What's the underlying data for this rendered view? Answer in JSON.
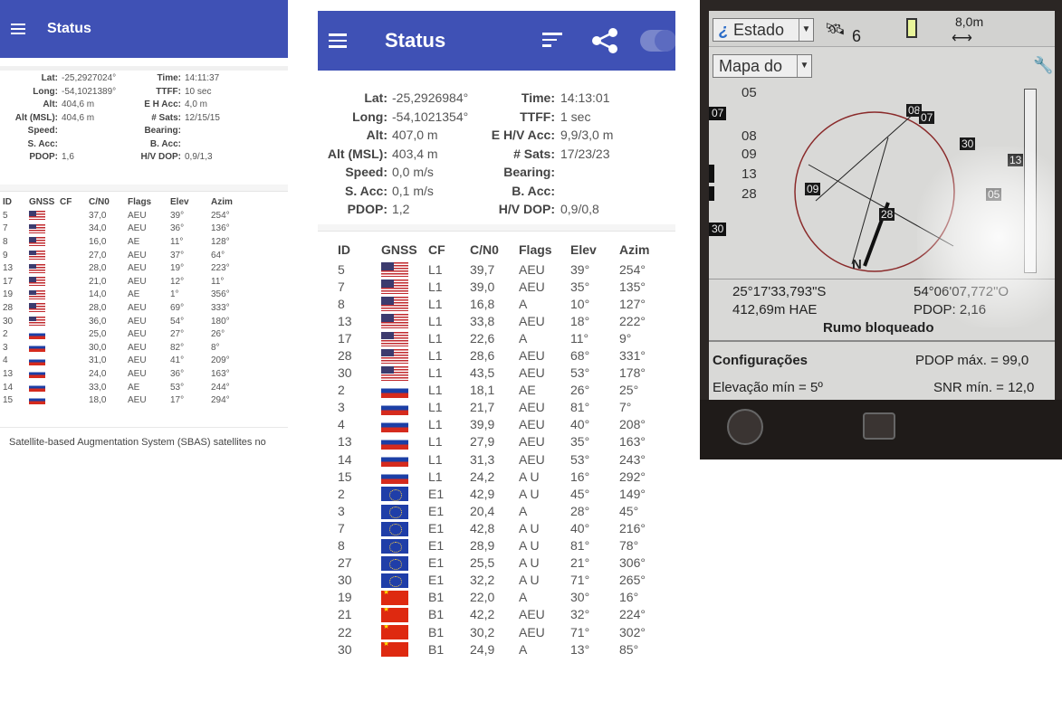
{
  "panel1": {
    "title": "Status",
    "info": [
      {
        "label": "Lat:",
        "value": "-25,2927024°"
      },
      {
        "label": "Long:",
        "value": "-54,1021389°"
      },
      {
        "label": "Alt:",
        "value": "404,6 m"
      },
      {
        "label": "Alt (MSL):",
        "value": "404,6 m"
      },
      {
        "label": "Speed:",
        "value": ""
      },
      {
        "label": "S. Acc:",
        "value": ""
      },
      {
        "label": "PDOP:",
        "value": "1,6"
      },
      {
        "label": "Time:",
        "value": "14:11:37"
      },
      {
        "label": "TTFF:",
        "value": "10 sec"
      },
      {
        "label": "E H Acc:",
        "value": "4,0 m"
      },
      {
        "label": "# Sats:",
        "value": "12/15/15"
      },
      {
        "label": "Bearing:",
        "value": ""
      },
      {
        "label": "B. Acc:",
        "value": ""
      },
      {
        "label": "H/V DOP:",
        "value": "0,9/1,3"
      }
    ],
    "columns": [
      "ID",
      "GNSS",
      "CF",
      "C/N0",
      "Flags",
      "Elev",
      "Azim"
    ],
    "rows": [
      {
        "id": "5",
        "flag": "us",
        "cf": "",
        "cn0": "37,0",
        "flags": "AEU",
        "elev": "39°",
        "azim": "254°"
      },
      {
        "id": "7",
        "flag": "us",
        "cf": "",
        "cn0": "34,0",
        "flags": "AEU",
        "elev": "36°",
        "azim": "136°"
      },
      {
        "id": "8",
        "flag": "us",
        "cf": "",
        "cn0": "16,0",
        "flags": "AE",
        "elev": "11°",
        "azim": "128°"
      },
      {
        "id": "9",
        "flag": "us",
        "cf": "",
        "cn0": "27,0",
        "flags": "AEU",
        "elev": "37°",
        "azim": "64°"
      },
      {
        "id": "13",
        "flag": "us",
        "cf": "",
        "cn0": "28,0",
        "flags": "AEU",
        "elev": "19°",
        "azim": "223°"
      },
      {
        "id": "17",
        "flag": "us",
        "cf": "",
        "cn0": "21,0",
        "flags": "AEU",
        "elev": "12°",
        "azim": "11°"
      },
      {
        "id": "19",
        "flag": "us",
        "cf": "",
        "cn0": "14,0",
        "flags": "AE",
        "elev": "1°",
        "azim": "356°"
      },
      {
        "id": "28",
        "flag": "us",
        "cf": "",
        "cn0": "28,0",
        "flags": "AEU",
        "elev": "69°",
        "azim": "333°"
      },
      {
        "id": "30",
        "flag": "us",
        "cf": "",
        "cn0": "36,0",
        "flags": "AEU",
        "elev": "54°",
        "azim": "180°"
      },
      {
        "id": "2",
        "flag": "ru",
        "cf": "",
        "cn0": "25,0",
        "flags": "AEU",
        "elev": "27°",
        "azim": "26°"
      },
      {
        "id": "3",
        "flag": "ru",
        "cf": "",
        "cn0": "30,0",
        "flags": "AEU",
        "elev": "82°",
        "azim": "8°"
      },
      {
        "id": "4",
        "flag": "ru",
        "cf": "",
        "cn0": "31,0",
        "flags": "AEU",
        "elev": "41°",
        "azim": "209°"
      },
      {
        "id": "13",
        "flag": "ru",
        "cf": "",
        "cn0": "24,0",
        "flags": "AEU",
        "elev": "36°",
        "azim": "163°"
      },
      {
        "id": "14",
        "flag": "ru",
        "cf": "",
        "cn0": "33,0",
        "flags": "AE",
        "elev": "53°",
        "azim": "244°"
      },
      {
        "id": "15",
        "flag": "ru",
        "cf": "",
        "cn0": "18,0",
        "flags": "AEU",
        "elev": "17°",
        "azim": "294°"
      }
    ],
    "footer": "Satellite-based Augmentation System (SBAS) satellites no"
  },
  "panel2": {
    "title": "Status",
    "info": [
      {
        "label": "Lat:",
        "value": "-25,2926984°"
      },
      {
        "label": "Long:",
        "value": "-54,1021354°"
      },
      {
        "label": "Alt:",
        "value": "407,0 m"
      },
      {
        "label": "Alt (MSL):",
        "value": "403,4 m"
      },
      {
        "label": "Speed:",
        "value": "0,0 m/s"
      },
      {
        "label": "S. Acc:",
        "value": "0,1 m/s"
      },
      {
        "label": "PDOP:",
        "value": "1,2"
      },
      {
        "label": "Time:",
        "value": "14:13:01"
      },
      {
        "label": "TTFF:",
        "value": "1 sec"
      },
      {
        "label": "E H/V Acc:",
        "value": "9,9/3,0 m"
      },
      {
        "label": "# Sats:",
        "value": "17/23/23"
      },
      {
        "label": "Bearing:",
        "value": ""
      },
      {
        "label": "B. Acc:",
        "value": ""
      },
      {
        "label": "H/V DOP:",
        "value": "0,9/0,8"
      }
    ],
    "columns": [
      "ID",
      "GNSS",
      "CF",
      "C/N0",
      "Flags",
      "Elev",
      "Azim"
    ],
    "rows": [
      {
        "id": "5",
        "flag": "us",
        "cf": "L1",
        "cn0": "39,7",
        "flags": "AEU",
        "elev": "39°",
        "azim": "254°"
      },
      {
        "id": "7",
        "flag": "us",
        "cf": "L1",
        "cn0": "39,0",
        "flags": "AEU",
        "elev": "35°",
        "azim": "135°"
      },
      {
        "id": "8",
        "flag": "us",
        "cf": "L1",
        "cn0": "16,8",
        "flags": "A",
        "elev": "10°",
        "azim": "127°"
      },
      {
        "id": "13",
        "flag": "us",
        "cf": "L1",
        "cn0": "33,8",
        "flags": "AEU",
        "elev": "18°",
        "azim": "222°"
      },
      {
        "id": "17",
        "flag": "us",
        "cf": "L1",
        "cn0": "22,6",
        "flags": "A",
        "elev": "11°",
        "azim": "9°"
      },
      {
        "id": "28",
        "flag": "us",
        "cf": "L1",
        "cn0": "28,6",
        "flags": "AEU",
        "elev": "68°",
        "azim": "331°"
      },
      {
        "id": "30",
        "flag": "us",
        "cf": "L1",
        "cn0": "43,5",
        "flags": "AEU",
        "elev": "53°",
        "azim": "178°"
      },
      {
        "id": "2",
        "flag": "ru",
        "cf": "L1",
        "cn0": "18,1",
        "flags": "AE",
        "elev": "26°",
        "azim": "25°"
      },
      {
        "id": "3",
        "flag": "ru",
        "cf": "L1",
        "cn0": "21,7",
        "flags": "AEU",
        "elev": "81°",
        "azim": "7°"
      },
      {
        "id": "4",
        "flag": "ru",
        "cf": "L1",
        "cn0": "39,9",
        "flags": "AEU",
        "elev": "40°",
        "azim": "208°"
      },
      {
        "id": "13",
        "flag": "ru",
        "cf": "L1",
        "cn0": "27,9",
        "flags": "AEU",
        "elev": "35°",
        "azim": "163°"
      },
      {
        "id": "14",
        "flag": "ru",
        "cf": "L1",
        "cn0": "31,3",
        "flags": "AEU",
        "elev": "53°",
        "azim": "243°"
      },
      {
        "id": "15",
        "flag": "ru",
        "cf": "L1",
        "cn0": "24,2",
        "flags": "A U",
        "elev": "16°",
        "azim": "292°"
      },
      {
        "id": "2",
        "flag": "eu",
        "cf": "E1",
        "cn0": "42,9",
        "flags": "A U",
        "elev": "45°",
        "azim": "149°"
      },
      {
        "id": "3",
        "flag": "eu",
        "cf": "E1",
        "cn0": "20,4",
        "flags": "A",
        "elev": "28°",
        "azim": "45°"
      },
      {
        "id": "7",
        "flag": "eu",
        "cf": "E1",
        "cn0": "42,8",
        "flags": "A U",
        "elev": "40°",
        "azim": "216°"
      },
      {
        "id": "8",
        "flag": "eu",
        "cf": "E1",
        "cn0": "28,9",
        "flags": "A U",
        "elev": "81°",
        "azim": "78°"
      },
      {
        "id": "27",
        "flag": "eu",
        "cf": "E1",
        "cn0": "25,5",
        "flags": "A U",
        "elev": "21°",
        "azim": "306°"
      },
      {
        "id": "30",
        "flag": "eu",
        "cf": "E1",
        "cn0": "32,2",
        "flags": "A U",
        "elev": "71°",
        "azim": "265°"
      },
      {
        "id": "19",
        "flag": "cn",
        "cf": "B1",
        "cn0": "22,0",
        "flags": "A",
        "elev": "30°",
        "azim": "16°"
      },
      {
        "id": "21",
        "flag": "cn",
        "cf": "B1",
        "cn0": "42,2",
        "flags": "AEU",
        "elev": "32°",
        "azim": "224°"
      },
      {
        "id": "22",
        "flag": "cn",
        "cf": "B1",
        "cn0": "30,2",
        "flags": "AEU",
        "elev": "71°",
        "azim": "302°"
      },
      {
        "id": "30",
        "flag": "cn",
        "cf": "B1",
        "cn0": "24,9",
        "flags": "A",
        "elev": "13°",
        "azim": "85°"
      }
    ]
  },
  "panel3": {
    "mode_select": "Estado",
    "sat_count": "6",
    "scale_label": "8,0m",
    "view_select": "Mapa do",
    "elevation_labels": [
      "05",
      "07",
      "08",
      "09",
      "13",
      "28",
      "30"
    ],
    "sky_sats": [
      "08",
      "07",
      "30",
      "13",
      "09",
      "05",
      "28"
    ],
    "north_label": "N",
    "lat": "25°17'33,793\"S",
    "lon": "54°06'07,772\"O",
    "altitude": "412,69m HAE",
    "pdop": "PDOP: 2,16",
    "heading_status": "Rumo bloqueado",
    "settings_label": "Configurações",
    "pdop_max": "PDOP máx. = 99,0",
    "elev_min": "Elevação mín = 5º",
    "snr_min": "SNR mín. = 12,0"
  },
  "colors": {
    "app_bar": "#3f51b5",
    "accent": "#5c6bc0"
  }
}
